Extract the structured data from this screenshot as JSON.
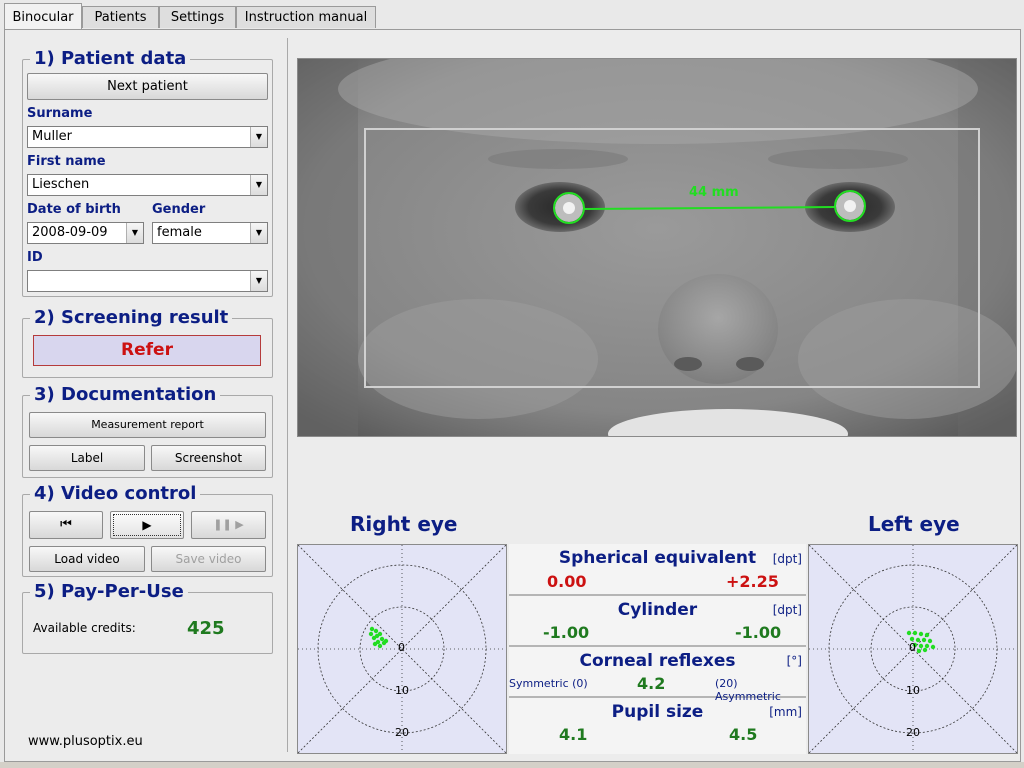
{
  "tabs": [
    "Binocular",
    "Patients",
    "Settings",
    "Instruction manual"
  ],
  "patient": {
    "section_title": "1) Patient data",
    "next_patient_label": "Next patient",
    "surname_label": "Surname",
    "surname_value": "Muller",
    "firstname_label": "First name",
    "firstname_value": "Lieschen",
    "dob_label": "Date of birth",
    "dob_value": "2008-09-09",
    "gender_label": "Gender",
    "gender_value": "female",
    "id_label": "ID",
    "id_value": ""
  },
  "screening": {
    "section_title": "2) Screening result",
    "result": "Refer",
    "result_color": "#cc1111"
  },
  "documentation": {
    "section_title": "3) Documentation",
    "report_label": "Measurement report",
    "label_label": "Label",
    "screenshot_label": "Screenshot"
  },
  "video": {
    "section_title": "4) Video control",
    "load_label": "Load video",
    "save_label": "Save video"
  },
  "payperuse": {
    "section_title": "5) Pay-Per-Use",
    "credits_label": "Available credits:",
    "credits_value": "425"
  },
  "footer": {
    "website": "www.plusoptix.eu"
  },
  "camera": {
    "pd_label": "44 mm"
  },
  "eyes": {
    "right_title": "Right eye",
    "left_title": "Left eye",
    "polar_ticks": [
      "0",
      "10",
      "20"
    ]
  },
  "results": {
    "spherical": {
      "title": "Spherical equivalent",
      "unit": "[dpt]",
      "right": "0.00",
      "left": "+2.25"
    },
    "cylinder": {
      "title": "Cylinder",
      "unit": "[dpt]",
      "right": "-1.00",
      "left": "-1.00"
    },
    "corneal": {
      "title": "Corneal reflexes",
      "unit": "[°]",
      "sym_label": "Symmetric (0)",
      "value": "4.2",
      "asym_label": "(20) Asymmetric"
    },
    "pupil": {
      "title": "Pupil size",
      "unit": "[mm]",
      "right": "4.1",
      "left": "4.5"
    }
  },
  "colors": {
    "accent": "#0c1e84",
    "good": "#1f7a1f",
    "bad": "#cc1111",
    "marker": "#22dd22"
  }
}
